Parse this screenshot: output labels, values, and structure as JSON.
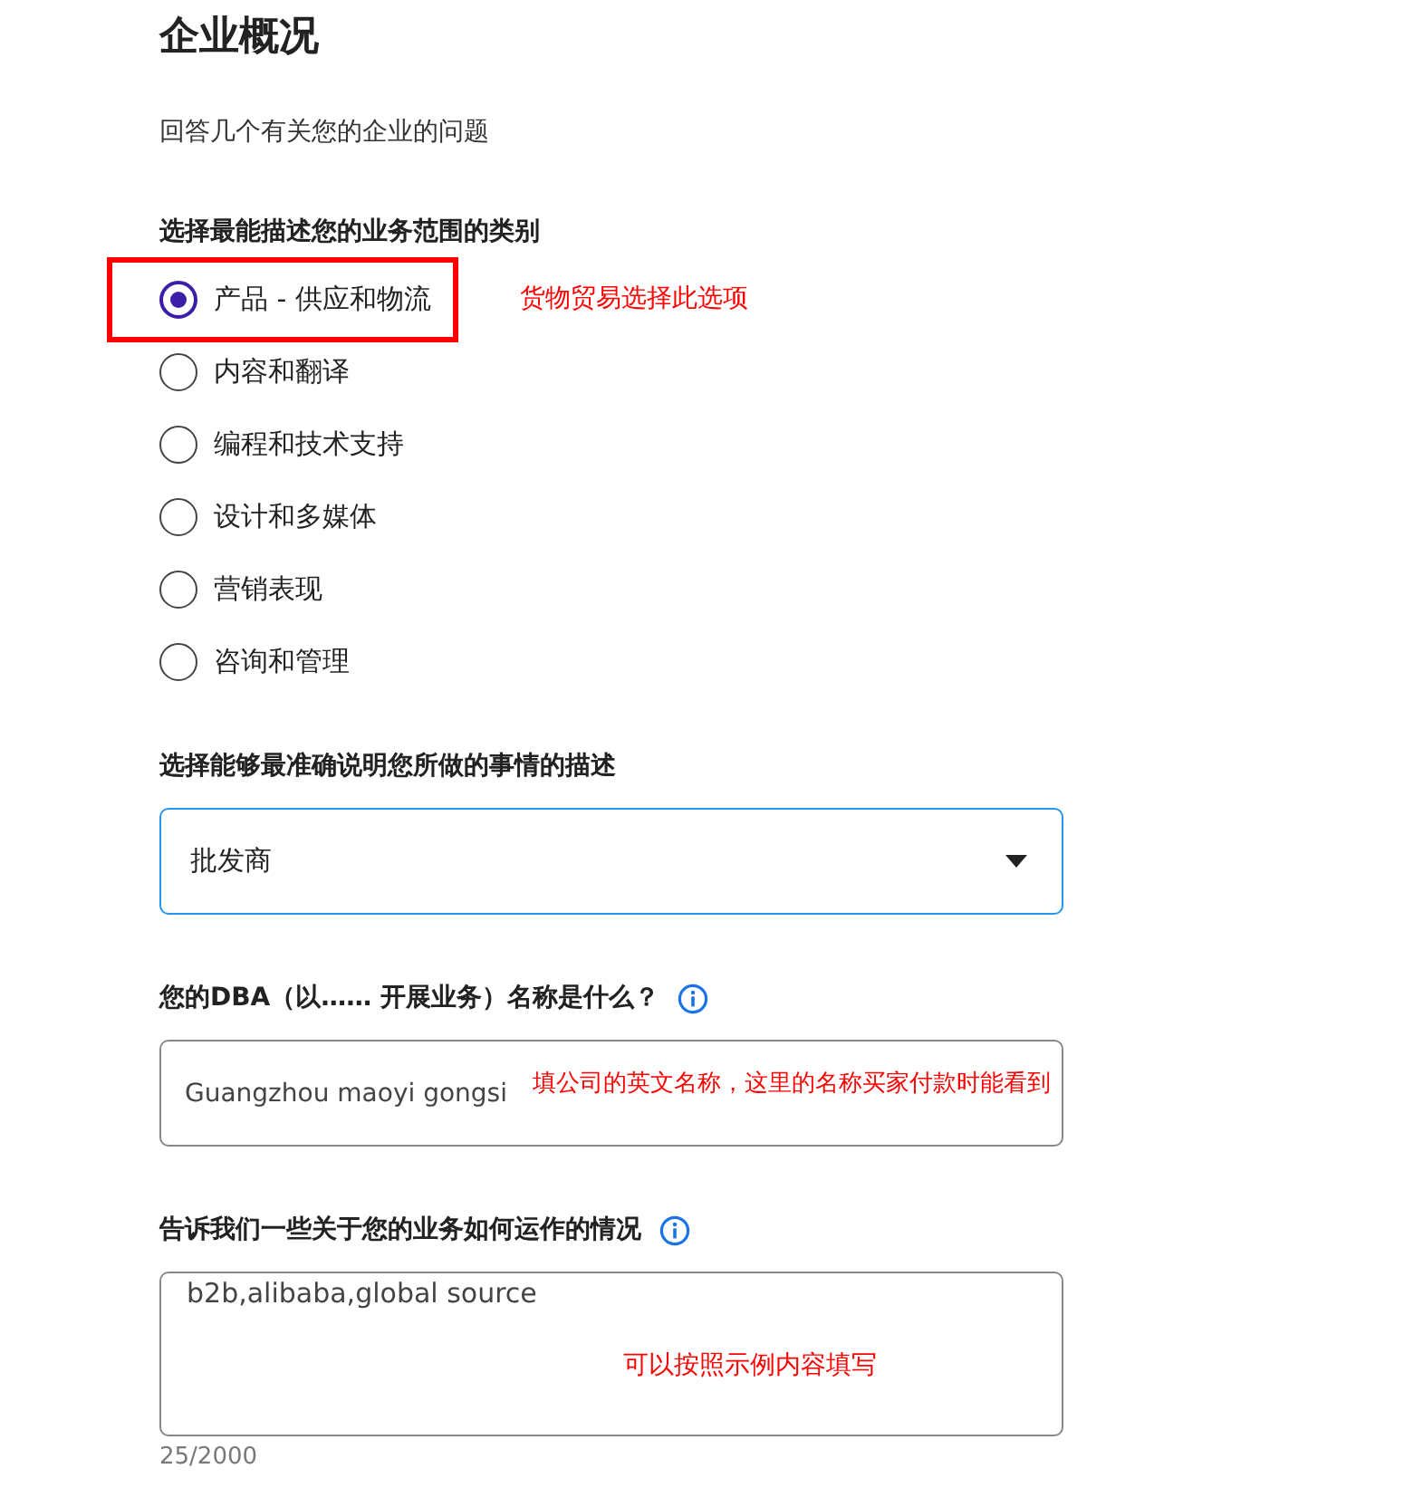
{
  "title": "企业概况",
  "subtitle": "回答几个有关您的企业的问题",
  "category": {
    "label": "选择最能描述您的业务范围的类别",
    "options": [
      {
        "label": "产品 - 供应和物流",
        "selected": true,
        "highlighted": true,
        "note": "货物贸易选择此选项"
      },
      {
        "label": "内容和翻译",
        "selected": false,
        "highlighted": false
      },
      {
        "label": "编程和技术支持",
        "selected": false,
        "highlighted": false
      },
      {
        "label": "设计和多媒体",
        "selected": false,
        "highlighted": false
      },
      {
        "label": "营销表现",
        "selected": false,
        "highlighted": false
      },
      {
        "label": "咨询和管理",
        "selected": false,
        "highlighted": false
      }
    ]
  },
  "description": {
    "label": "选择能够最准确说明您所做的事情的描述",
    "value": "批发商"
  },
  "dba": {
    "label": "您的DBA（以…… 开展业务）名称是什么？",
    "value": "Guangzhou maoyi gongsi",
    "note": "填公司的英文名称，这里的名称买家付款时能看到"
  },
  "operation": {
    "label": "告诉我们一些关于您的业务如何运作的情况",
    "value": "b2b,alibaba,global source",
    "counter": "25/2000",
    "note": "可以按照示例内容填写"
  }
}
